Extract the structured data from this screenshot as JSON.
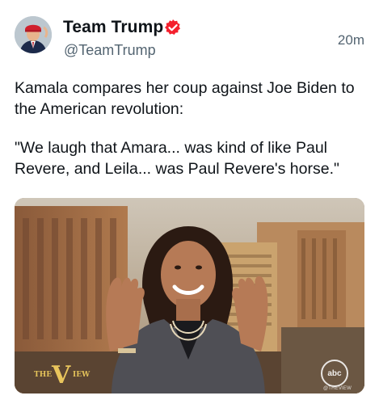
{
  "post": {
    "author_name": "Team Trump",
    "handle": "@TeamTrump",
    "timestamp": "20m",
    "verified_icon": "verified-badge-icon",
    "text_line1": "Kamala compares her coup against Joe Biden to the American revolution:",
    "text_line2": "\"We laugh that Amara... was kind of like Paul Revere, and Leila... was Paul Revere's horse.\""
  },
  "media": {
    "logo_the": "THE",
    "logo_v": "V",
    "logo_ew": "IEW",
    "network": "abc",
    "network_tag": "@THEVIEW"
  },
  "colors": {
    "badge": "#f4212e",
    "secondary_text": "#536471",
    "primary_text": "#0f1419"
  }
}
